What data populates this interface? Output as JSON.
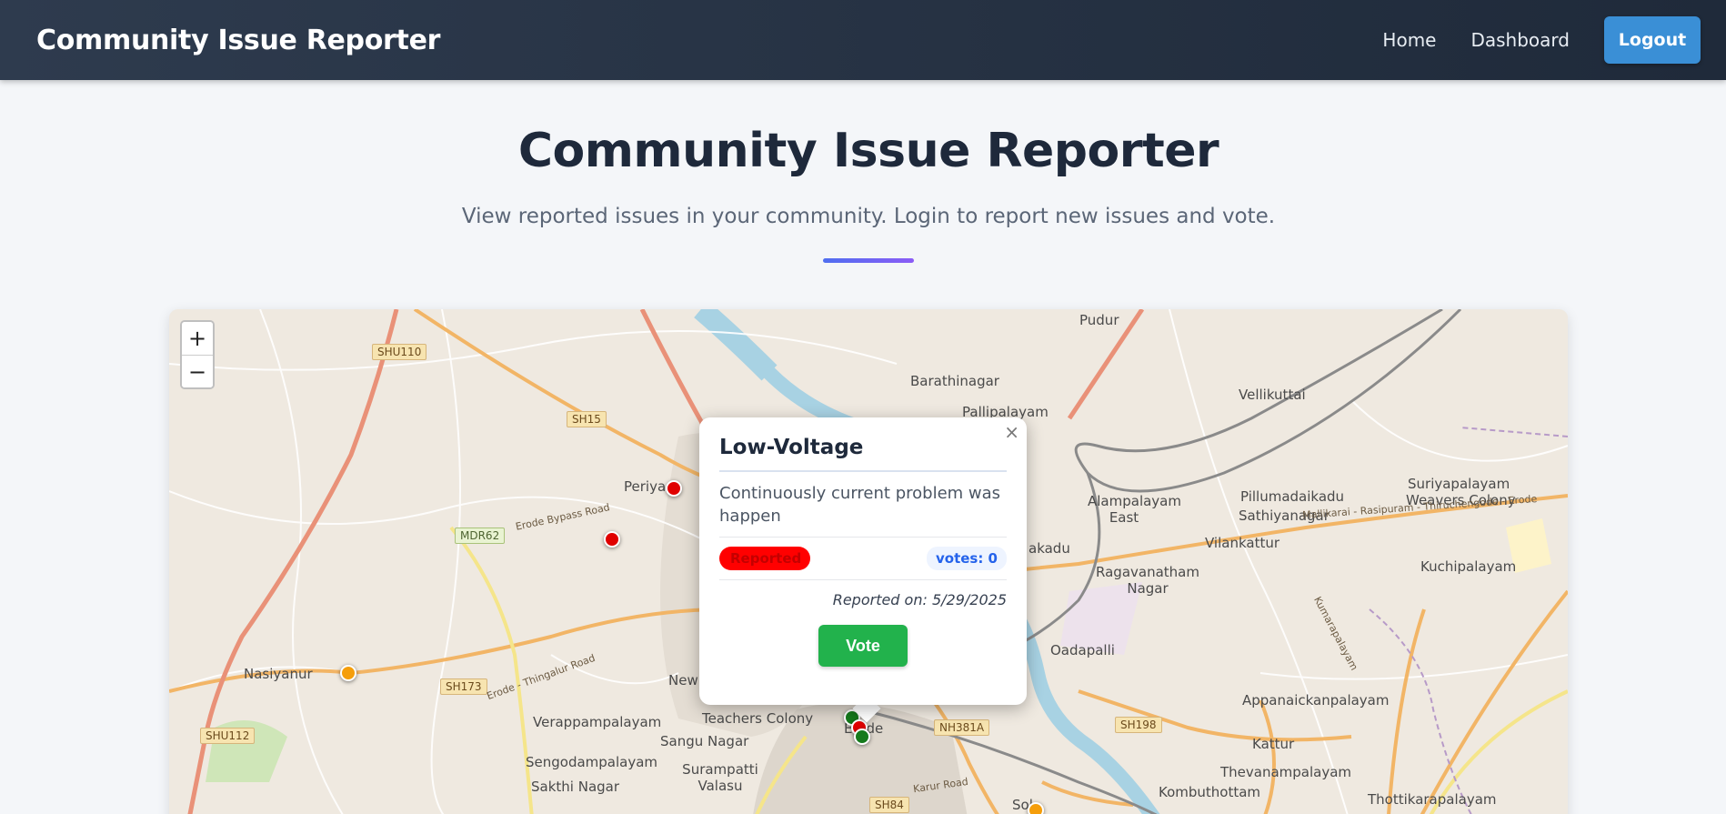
{
  "navbar": {
    "brand": "Community Issue Reporter",
    "links": [
      "Home",
      "Dashboard"
    ],
    "logout_label": "Logout"
  },
  "hero": {
    "title": "Community Issue Reporter",
    "subtitle": "View reported issues in your community. Login to report new issues and vote."
  },
  "map": {
    "zoom_in": "+",
    "zoom_out": "−",
    "place_labels": [
      "Pudur",
      "Barathinagar",
      "Pallipalayam",
      "Vellikuttai",
      "Suriyapalayam",
      "Weavers Colony",
      "Sathiyanagar",
      "Pillumadaikadu",
      "Alampalayam East",
      "Vilankattur",
      "Ragavanatham Nagar",
      "Kuchipalayam",
      "Oadapalli",
      "Periya",
      "Nasiyanur",
      "Verappampalayam",
      "Teachers Colony",
      "Sangu Nagar",
      "Sengodampalayam",
      "Surampatti Valasu",
      "Sakthi Nagar",
      "Appanaickanpalayam",
      "Kattur",
      "Thevanampalayam",
      "Kombuthottam",
      "Thottikarapalayam",
      "New",
      "Erode",
      "akadu",
      "Sol"
    ],
    "road_badges": [
      "SHU110",
      "SH15",
      "MDR62",
      "SH173",
      "SHU112",
      "SH198",
      "NH381A",
      "SH84"
    ],
    "road_names": [
      "Erode Bypass Road",
      "Erode - Thingalur Road",
      "Karur Road",
      "Mallikarai - Rasipuram - Thiruchengode - Erode",
      "Kumarapalayam"
    ],
    "marker_colors": {
      "reported": "#e00000",
      "in_progress": "#f59e0b",
      "resolved": "#157a1c"
    }
  },
  "popup": {
    "close": "×",
    "title": "Low-Voltage",
    "description": "Continuously current problem was happen",
    "status": "Reported",
    "votes": "votes: 0",
    "date": "Reported on: 5/29/2025",
    "vote_label": "Vote"
  }
}
